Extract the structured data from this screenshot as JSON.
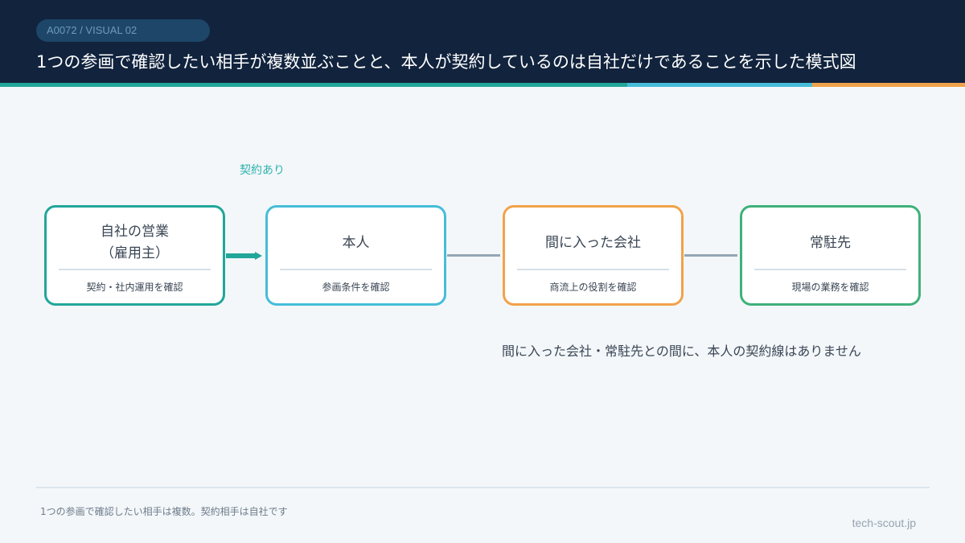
{
  "header": {
    "tag": "A0072 / VISUAL 02",
    "title": "1つの参画で確認したい相手が複数並ぶことと、本人が契約しているのは自社だけであることを示した模式図"
  },
  "diagram": {
    "contract_label": "契約あり",
    "nodes": [
      {
        "name": "自社の営業\n（雇用主）",
        "sub": "契約・社内運用を確認",
        "color": "#21a69a"
      },
      {
        "name": "本人",
        "sub": "参画条件を確認",
        "color": "#45bdd8"
      },
      {
        "name": "間に入った会社",
        "sub": "商流上の役割を確認",
        "color": "#f2a24a"
      },
      {
        "name": "常駐先",
        "sub": "現場の業務を確認",
        "color": "#3fb17a"
      }
    ],
    "note": "間に入った会社・常駐先との間に、本人の契約線はありません"
  },
  "footer": {
    "caption": "1つの参画で確認したい相手は複数。契約相手は自社です",
    "brand": "tech-scout.jp"
  },
  "colors": {
    "header_bg": "#11233d",
    "stripe": [
      "#21a79a",
      "#47bcd8",
      "#f0a24a"
    ],
    "connector": "#95a6b5"
  }
}
